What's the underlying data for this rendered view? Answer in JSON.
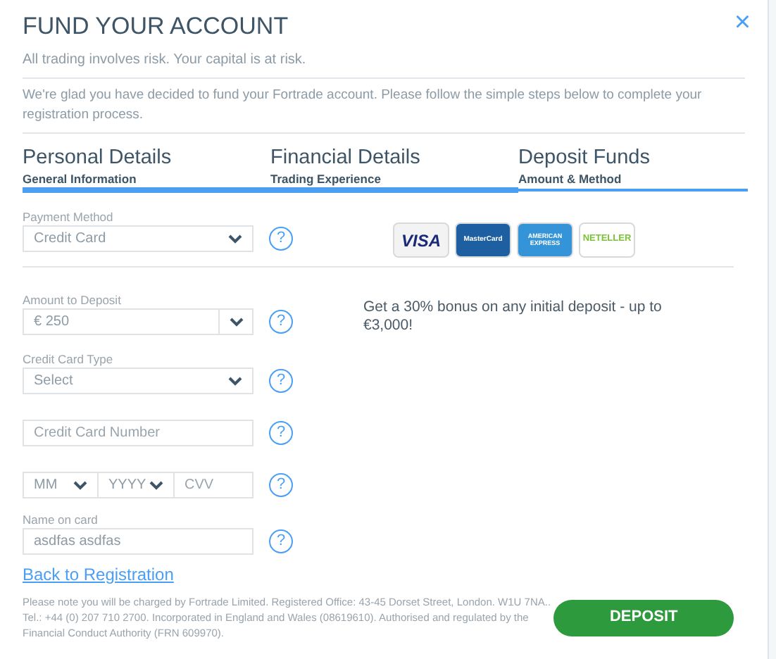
{
  "dialog": {
    "title": "FUND YOUR ACCOUNT",
    "risk_note": "All trading involves risk. Your capital is at risk.",
    "intro": "We're glad you have decided to fund your Fortrade account. Please follow the simple steps below to complete your registration process.",
    "close": "×"
  },
  "steps": [
    {
      "title": "Personal Details",
      "subtitle": "General Information",
      "completed": true
    },
    {
      "title": "Financial Details",
      "subtitle": "Trading Experience",
      "completed": true
    },
    {
      "title": "Deposit Funds",
      "subtitle": "Amount & Method",
      "completed": false
    }
  ],
  "fields": [
    {
      "kind": "select",
      "label": "Payment Method",
      "value": "Credit Card",
      "help": "?"
    },
    {
      "kind": "split-select",
      "label": "Amount to Deposit",
      "value": "€ 250",
      "help": "?"
    },
    {
      "kind": "select",
      "label": "Credit Card Type",
      "value": "Select",
      "help": "?"
    },
    {
      "kind": "input",
      "placeholder": "Credit Card Number",
      "help": "?"
    },
    {
      "kind": "expiry",
      "month": "MM",
      "year": "YYYY",
      "cvv_placeholder": "CVV",
      "help": "?"
    },
    {
      "kind": "input",
      "label": "Name on card",
      "value": "asdfas asdfas",
      "help": "?"
    }
  ],
  "payment_logos": [
    {
      "kind": "visa",
      "label": "VISA"
    },
    {
      "kind": "mastercard",
      "label": "MasterCard"
    },
    {
      "kind": "amex",
      "label": "AMERICAN EXPRESS"
    },
    {
      "kind": "neteller",
      "label": "NETELLER"
    }
  ],
  "bonus_text": "Get a 30% bonus on any initial deposit - up to €3,000!",
  "back_link": "Back to Registration",
  "footer_note": "Please note you will be charged by Fortrade Limited. Registered Office: 43-45 Dorset Street, London. W1U 7NA.. Tel.: +44 (0) 207 710 2700. Incorporated in England and Wales (08619610). Authorised and regulated by the Financial Conduct Authority (FRN 609970).",
  "deposit_button": "DEPOSIT"
}
